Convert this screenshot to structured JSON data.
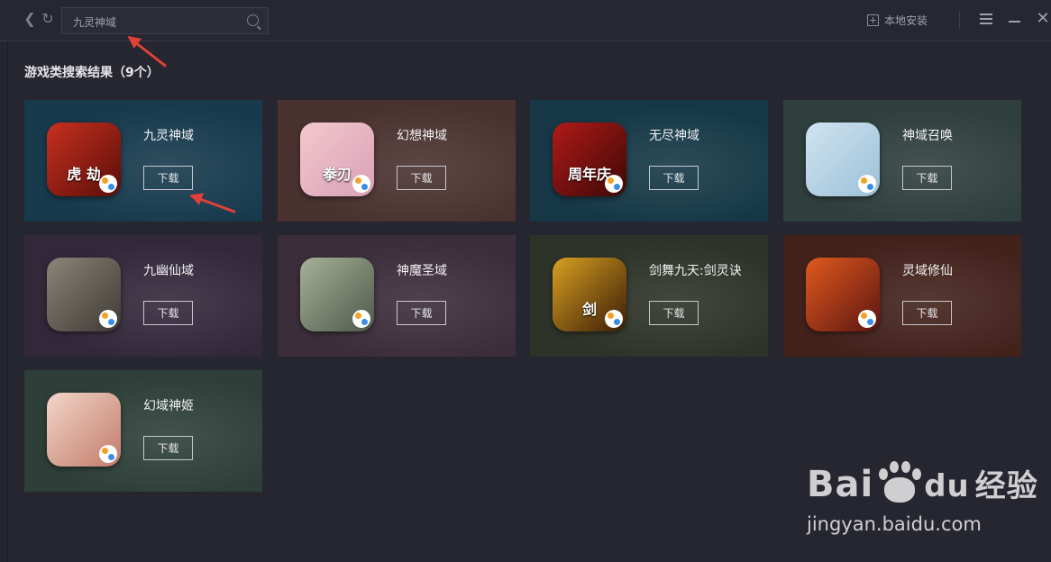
{
  "topbar": {
    "back_glyph": "❮",
    "refresh_glyph": "↻",
    "search_value": "九灵神域",
    "local_install_label": "本地安装",
    "close_glyph": "✕"
  },
  "results": {
    "title": "游戏类搜索结果（9个）"
  },
  "games": [
    {
      "name": "九灵神域",
      "download_label": "下载",
      "icon_text": "虎 劫",
      "bg": "#173a4d",
      "icon_colors": [
        "#c8301f",
        "#5a0e08"
      ]
    },
    {
      "name": "幻想神域",
      "download_label": "下载",
      "icon_text": "拳刃",
      "bg": "#4a3230",
      "icon_colors": [
        "#f4c8cc",
        "#d8a0b8"
      ]
    },
    {
      "name": "无尽神域",
      "download_label": "下载",
      "icon_text": "周年庆",
      "bg": "#163846",
      "icon_colors": [
        "#b01a18",
        "#3c0806"
      ]
    },
    {
      "name": "神域召唤",
      "download_label": "下载",
      "icon_text": "",
      "bg": "#2f3f3d",
      "icon_colors": [
        "#cfe4f0",
        "#9cc0d8"
      ]
    },
    {
      "name": "九幽仙域",
      "download_label": "下载",
      "icon_text": "",
      "bg": "#33283a",
      "icon_colors": [
        "#8a8478",
        "#3e3a34"
      ]
    },
    {
      "name": "神魔圣域",
      "download_label": "下载",
      "icon_text": "",
      "bg": "#3b2d3a",
      "icon_colors": [
        "#a8b098",
        "#4c5a48"
      ]
    },
    {
      "name": "剑舞九天:剑灵诀",
      "download_label": "下载",
      "icon_text": "剑",
      "bg": "#2d3328",
      "icon_colors": [
        "#d8a020",
        "#3a1c08"
      ]
    },
    {
      "name": "灵域修仙",
      "download_label": "下载",
      "icon_text": "",
      "bg": "#43221c",
      "icon_colors": [
        "#e05a1e",
        "#5c1410"
      ]
    },
    {
      "name": "幻域神姬",
      "download_label": "下载",
      "icon_text": "",
      "bg": "#2d3f38",
      "icon_colors": [
        "#f2d6c8",
        "#c27a6a"
      ]
    }
  ],
  "watermark": {
    "brand_left": "Bai",
    "brand_mid": "du",
    "brand_right": "经验",
    "url": "jingyan.baidu.com"
  }
}
